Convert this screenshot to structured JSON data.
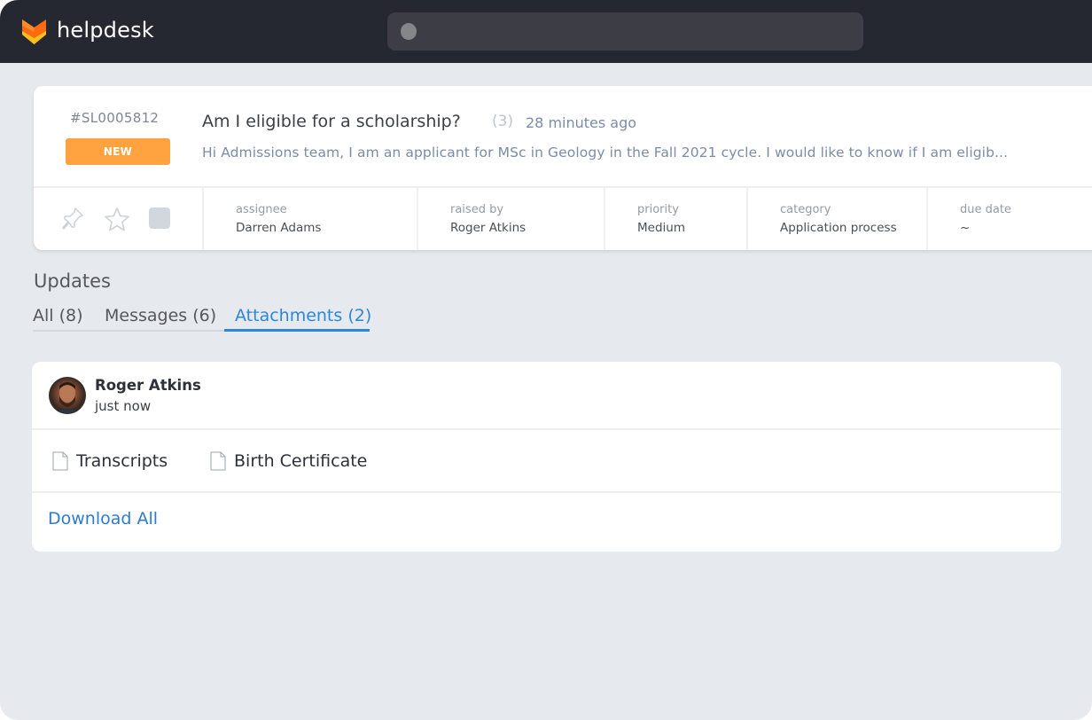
{
  "app": {
    "brand": "helpdesk",
    "brand_colors": {
      "logo_primary": "#ff6a10",
      "logo_secondary": "#ffc01f"
    },
    "search": {
      "placeholder": ""
    }
  },
  "ticket": {
    "id": "#SL0005812",
    "status": "NEW",
    "status_color": "#ffa23f",
    "title": "Am I eligible for a scholarship?",
    "count": "(3)",
    "time": "28 minutes ago",
    "preview": "Hi Admissions team, I am an applicant for MSc in Geology in the Fall 2021 cycle. I would like to know if I am eligib...",
    "actions": {
      "pin": "pin-icon",
      "star": "star-icon",
      "select": "checkbox"
    },
    "meta": [
      {
        "label": "assignee",
        "value": "Darren Adams"
      },
      {
        "label": "raised by",
        "value": "Roger Atkins"
      },
      {
        "label": "priority",
        "value": "Medium"
      },
      {
        "label": "category",
        "value": "Application process"
      },
      {
        "label": "due date",
        "value": "~"
      }
    ]
  },
  "updates": {
    "title": "Updates",
    "tabs": [
      {
        "label": "All (8)",
        "active": false
      },
      {
        "label": "Messages (6)",
        "active": false
      },
      {
        "label": "Attachments (2)",
        "active": true
      }
    ],
    "accent_color": "#2d87d9",
    "items": [
      {
        "author": "Roger Atkins",
        "time": "just now",
        "attachments": [
          {
            "name": "Transcripts",
            "icon": "file-icon"
          },
          {
            "name": "Birth Certificate",
            "icon": "file-icon"
          }
        ],
        "download_label": "Download All"
      }
    ]
  }
}
